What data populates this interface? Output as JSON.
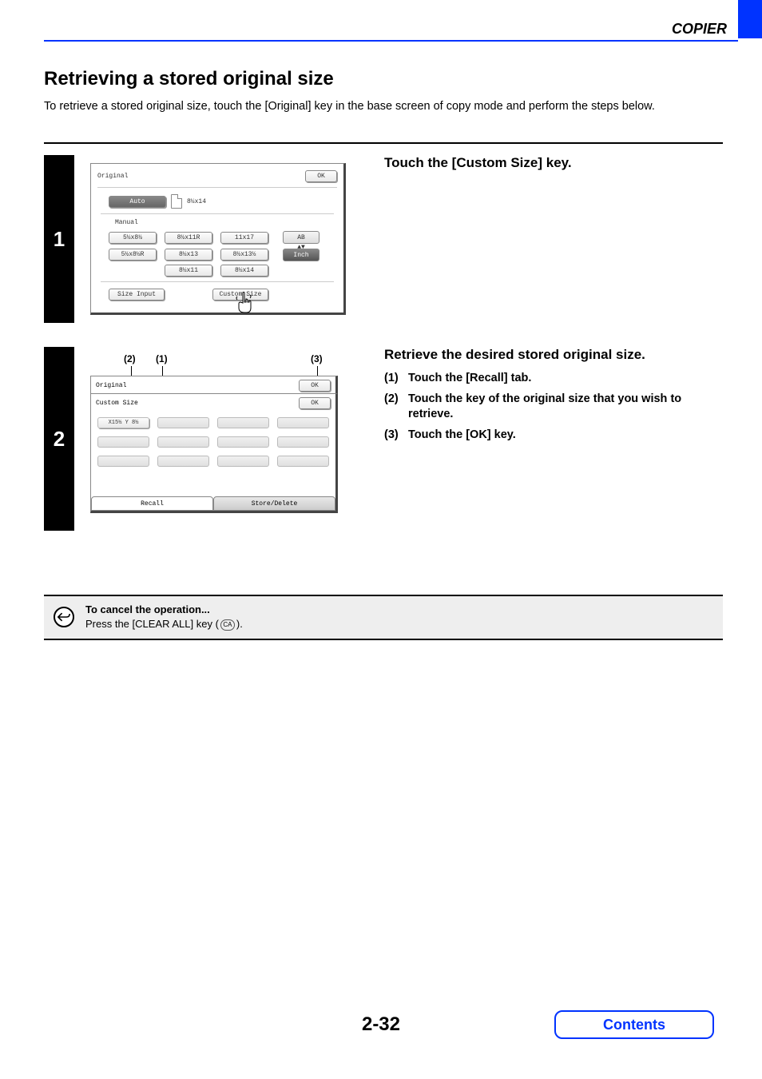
{
  "header": {
    "section": "COPIER"
  },
  "title": "Retrieving a stored original size",
  "intro": "To retrieve a stored original size, touch the [Original] key in the base screen of copy mode and perform the steps below.",
  "step1": {
    "num": "1",
    "title": "Touch the [Custom Size] key.",
    "panel": {
      "name": "Original",
      "ok": "OK",
      "auto": "Auto",
      "auto_size": "8½x14",
      "manual": "Manual",
      "sizes": [
        "5½x8½",
        "8½x11R",
        "11x17",
        "5½x8½R",
        "8½x13",
        "8½x13½",
        "8½x11",
        "8½x14"
      ],
      "ab": "AB",
      "inch": "Inch",
      "size_input": "Size Input",
      "custom_size": "Custom Size"
    }
  },
  "step2": {
    "num": "2",
    "title": "Retrieve the desired stored original size.",
    "items": [
      {
        "num": "(1)",
        "text": "Touch the [Recall] tab."
      },
      {
        "num": "(2)",
        "text": "Touch the key of the original size that you wish to retrieve."
      },
      {
        "num": "(3)",
        "text": "Touch the [OK] key."
      }
    ],
    "callouts": {
      "c1": "(1)",
      "c2": "(2)",
      "c3": "(3)"
    },
    "panel": {
      "original": "Original",
      "custom_size": "Custom Size",
      "ok": "OK",
      "slot_filled": "X15½ Y 8½",
      "tab_recall": "Recall",
      "tab_store": "Store/Delete"
    }
  },
  "note": {
    "title": "To cancel the operation...",
    "text_a": "Press the [CLEAR ALL] key (",
    "text_b": ").",
    "ca": "CA"
  },
  "footer": {
    "page": "2-32",
    "contents": "Contents"
  }
}
